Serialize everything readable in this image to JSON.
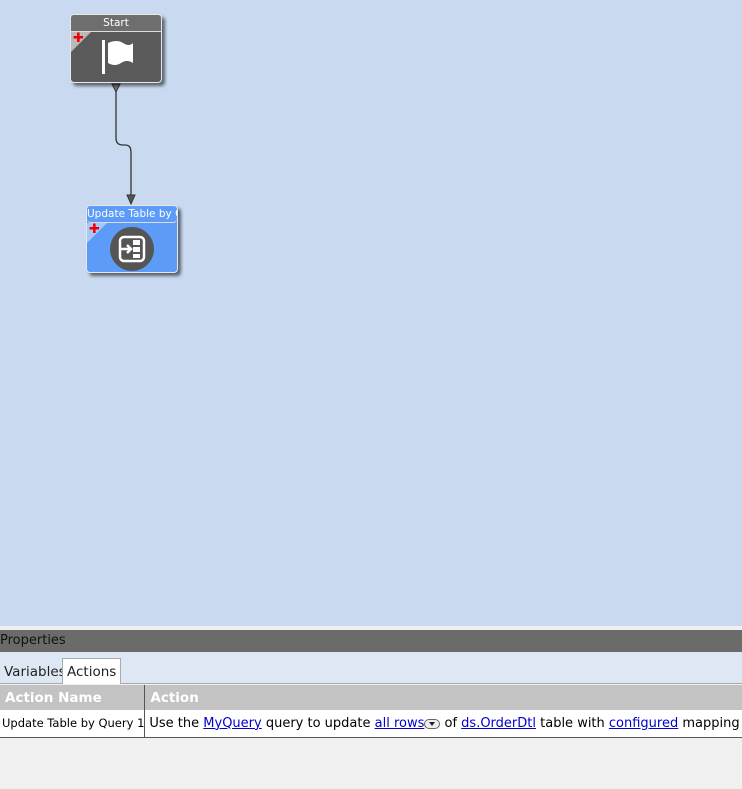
{
  "canvas": {
    "nodes": [
      {
        "title": "Start",
        "icon": "flag-icon"
      },
      {
        "title": "Update Table by Q",
        "icon": "update-table-icon"
      }
    ]
  },
  "properties": {
    "title": "Properties",
    "tabs": [
      "Variables",
      "Actions"
    ],
    "active_tab": "Actions",
    "columns": [
      "Action Name",
      "Action"
    ],
    "rows": [
      {
        "name": "Update Table by Query 1",
        "action": {
          "t1": "Use the ",
          "query": "MyQuery",
          "t2": " query to update ",
          "rows": "all rows",
          "t3": " of ",
          "table": "ds.OrderDtl",
          "t4": " table with ",
          "mapping": "configured",
          "t5": " mapping"
        }
      }
    ]
  }
}
